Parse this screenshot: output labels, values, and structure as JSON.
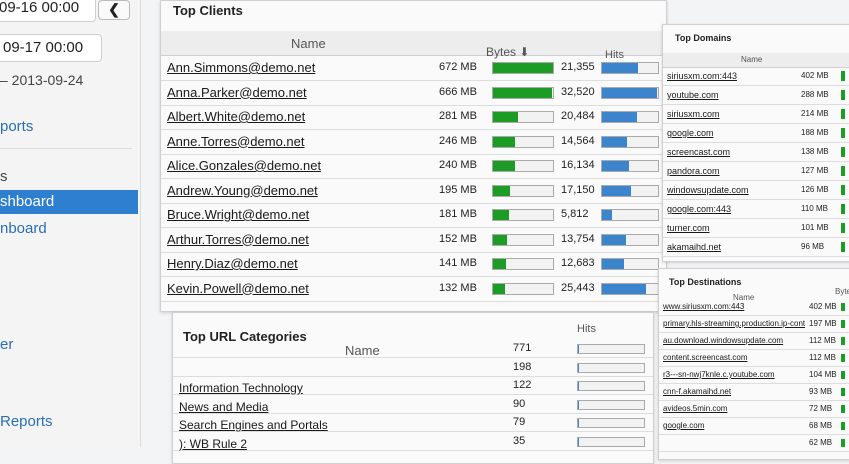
{
  "sidebar": {
    "date_start": "09-16 00:00",
    "date_end": "09-17 00:00",
    "range": "– 2013-09-24",
    "nav_reports": "ports",
    "nav_s": "s",
    "nav_dashboard": "shboard",
    "nav_board": "nboard",
    "nav_er": "er",
    "nav_reports2": "Reports"
  },
  "top_clients": {
    "title": "Top Clients",
    "col_name": "Name",
    "col_bytes": "Bytes ⬇",
    "col_hits": "Hits",
    "rows": [
      {
        "name": "Ann.Simmons@demo.net",
        "bytes": "672 MB",
        "bytes_frac": 1.0,
        "hits": "21,355",
        "hits_frac": 0.64
      },
      {
        "name": "Anna.Parker@demo.net",
        "bytes": "666 MB",
        "bytes_frac": 0.99,
        "hits": "32,520",
        "hits_frac": 0.98
      },
      {
        "name": "Albert.White@demo.net",
        "bytes": "281 MB",
        "bytes_frac": 0.42,
        "hits": "20,484",
        "hits_frac": 0.62
      },
      {
        "name": "Anne.Torres@demo.net",
        "bytes": "246 MB",
        "bytes_frac": 0.37,
        "hits": "14,564",
        "hits_frac": 0.44
      },
      {
        "name": "Alice.Gonzales@demo.net",
        "bytes": "240 MB",
        "bytes_frac": 0.36,
        "hits": "16,134",
        "hits_frac": 0.49
      },
      {
        "name": "Andrew.Young@demo.net",
        "bytes": "195 MB",
        "bytes_frac": 0.29,
        "hits": "17,150",
        "hits_frac": 0.52
      },
      {
        "name": "Bruce.Wright@demo.net",
        "bytes": "181 MB",
        "bytes_frac": 0.27,
        "hits": "5,812",
        "hits_frac": 0.18
      },
      {
        "name": "Arthur.Torres@demo.net",
        "bytes": "152 MB",
        "bytes_frac": 0.23,
        "hits": "13,754",
        "hits_frac": 0.42
      },
      {
        "name": "Henry.Diaz@demo.net",
        "bytes": "141 MB",
        "bytes_frac": 0.21,
        "hits": "12,683",
        "hits_frac": 0.39
      },
      {
        "name": "Kevin.Powell@demo.net",
        "bytes": "132 MB",
        "bytes_frac": 0.2,
        "hits": "25,443",
        "hits_frac": 0.78
      }
    ]
  },
  "top_url_categories": {
    "title": "Top URL Categories",
    "col_name": "Name",
    "col_hits": "Hits",
    "rows": [
      {
        "name": "",
        "hits": "771"
      },
      {
        "name": "",
        "hits": "198"
      },
      {
        "name": "Information Technology",
        "hits": "122"
      },
      {
        "name": "News and Media",
        "hits": "90"
      },
      {
        "name": "Search Engines and Portals",
        "hits": "79"
      },
      {
        "name": "): WB Rule 2",
        "hits": "35"
      }
    ]
  },
  "top_domains": {
    "title": "Top Domains",
    "col_name": "Name",
    "rows": [
      {
        "name": "siriusxm.com:443",
        "bytes": "402 MB"
      },
      {
        "name": "youtube.com",
        "bytes": "288 MB"
      },
      {
        "name": "siriusxm.com",
        "bytes": "214 MB"
      },
      {
        "name": "google.com",
        "bytes": "188 MB"
      },
      {
        "name": "screencast.com",
        "bytes": "138 MB"
      },
      {
        "name": "pandora.com",
        "bytes": "127 MB"
      },
      {
        "name": "windowsupdate.com",
        "bytes": "126 MB"
      },
      {
        "name": "google.com:443",
        "bytes": "110 MB"
      },
      {
        "name": "turner.com",
        "bytes": "101 MB"
      },
      {
        "name": "akamaihd.net",
        "bytes": "96 MB"
      }
    ]
  },
  "top_destinations": {
    "title": "Top Destinations",
    "col_name": "Name",
    "col_bytes": "Byte",
    "rows": [
      {
        "name": "www.siriusxm.com:443",
        "bytes": "402 MB"
      },
      {
        "name": "primary.hls-streaming.production.ip-content.siri",
        "bytes": "197 MB"
      },
      {
        "name": "au.download.windowsupdate.com",
        "bytes": "112 MB"
      },
      {
        "name": "content.screencast.com",
        "bytes": "112 MB"
      },
      {
        "name": "r3---sn-nwj7knle.c.youtube.com",
        "bytes": "104 MB"
      },
      {
        "name": "cnn-f.akamaihd.net",
        "bytes": "93 MB"
      },
      {
        "name": "avideos.5min.com",
        "bytes": "72 MB"
      },
      {
        "name": "google.com",
        "bytes": "68 MB"
      },
      {
        "name": "",
        "bytes": "62 MB"
      }
    ]
  },
  "colors": {
    "bytes_bar": "#1c9b25",
    "hits_bar": "#3c84cc",
    "nav_selected": "#2f7fd0"
  }
}
